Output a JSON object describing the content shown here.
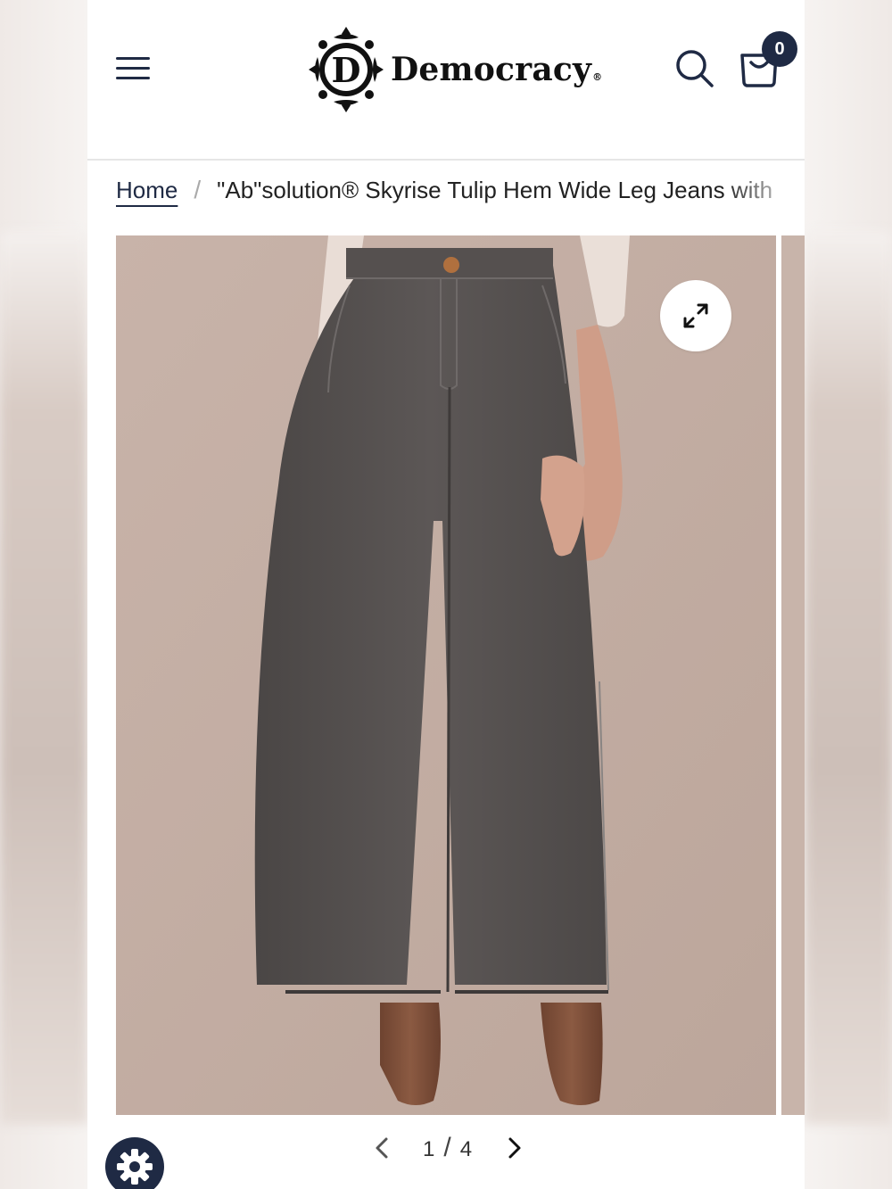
{
  "header": {
    "brand_name": "Democracy",
    "brand_registered": "®",
    "logo_letter": "D",
    "cart_count": "0",
    "icons": {
      "menu": "hamburger-menu-icon",
      "search": "search-icon",
      "cart": "shopping-bag-icon"
    }
  },
  "breadcrumb": {
    "home_label": "Home",
    "separator": "/",
    "current_label": "\"Ab\"solution® Skyrise Tulip Hem Wide Leg Jeans with"
  },
  "gallery": {
    "image_alt": "Grey wide leg jeans with tulip hem worn with brown suede boots",
    "expand_icon": "expand-icon",
    "pagination": {
      "current": "1",
      "separator": "/",
      "total": "4"
    }
  },
  "colors": {
    "navy": "#1f2a44",
    "photo_background": "#c4afa5",
    "denim": "#55504f"
  },
  "floating": {
    "settings_icon": "gear-icon"
  }
}
